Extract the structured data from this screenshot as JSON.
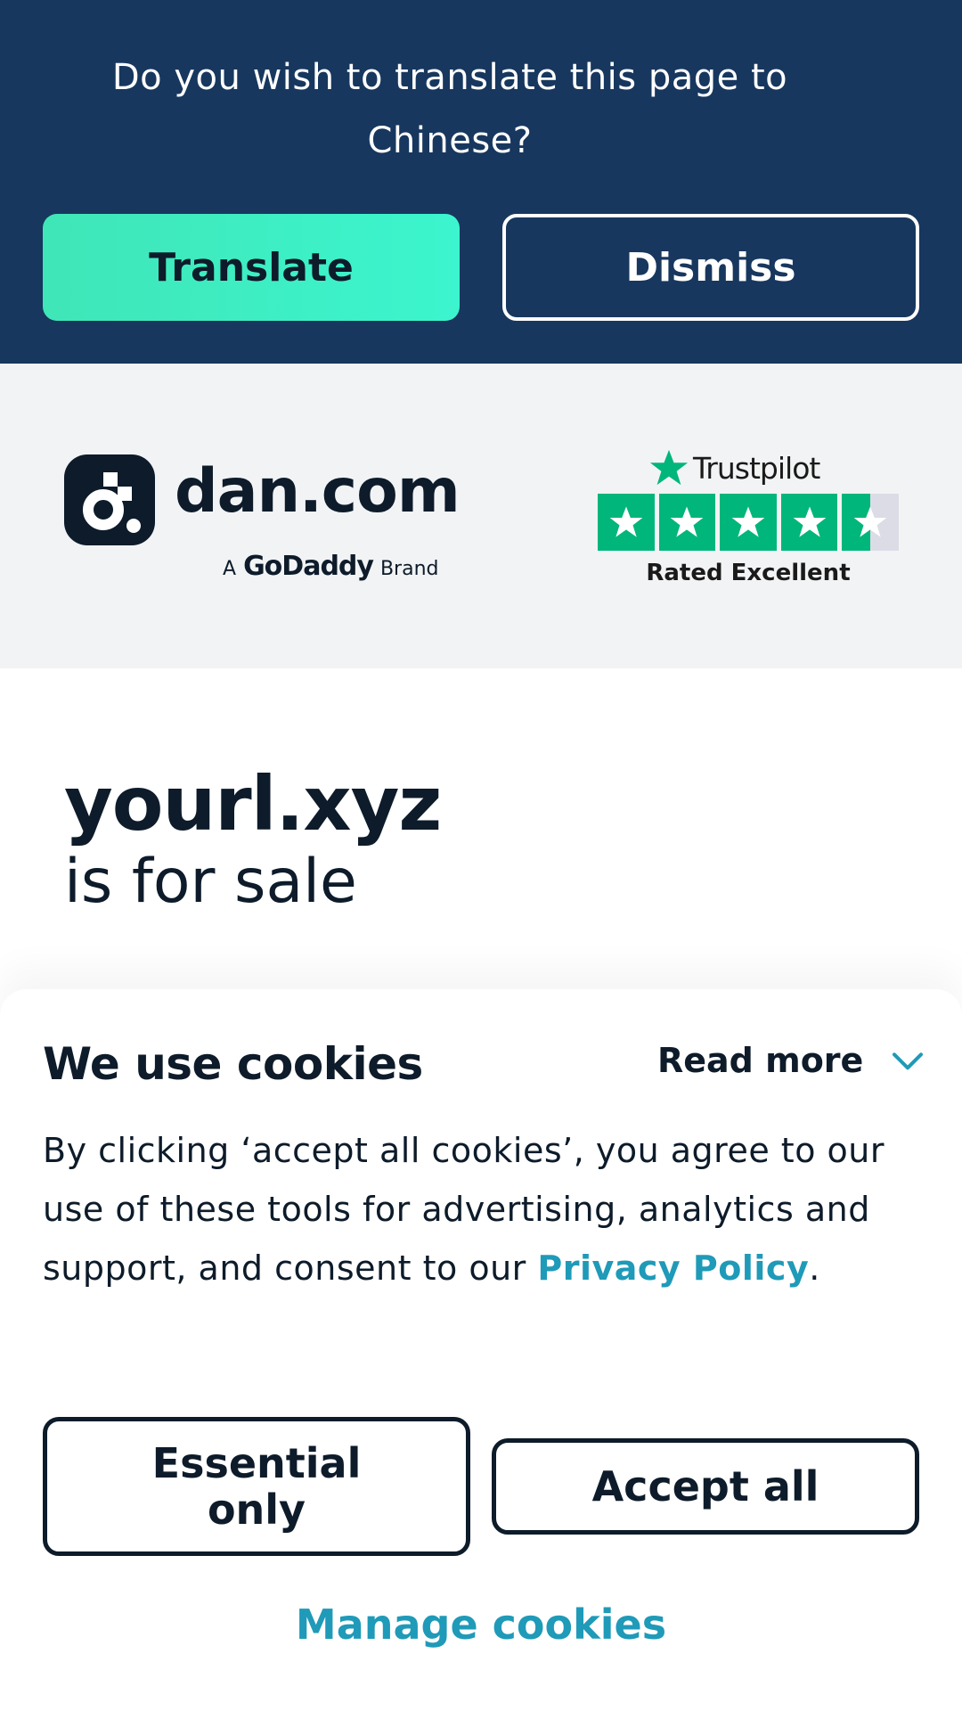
{
  "translate_banner": {
    "question": "Do you wish to translate this page to Chinese?",
    "translate_label": "Translate",
    "dismiss_label": "Dismiss"
  },
  "header": {
    "logo_text": "dan.com",
    "brand_prefix": "A",
    "brand_name": "GoDaddy",
    "brand_suffix": "Brand",
    "trustpilot_label": "Trustpilot",
    "trustpilot_rating_text": "Rated Excellent",
    "trustpilot_stars": 4.5
  },
  "hero": {
    "domain": "yourl.xyz",
    "tagline": "is for sale"
  },
  "cookie_panel": {
    "title": "We use cookies",
    "read_more_label": "Read more",
    "body_text": "By clicking ‘accept all cookies’, you agree to our use of these tools for advertising, analytics and support, and consent to our ",
    "privacy_link": "Privacy Policy",
    "body_end": ".",
    "essential_label": "Essential only",
    "accept_label": "Accept all",
    "manage_label": "Manage cookies"
  },
  "colors": {
    "banner_bg": "#17375e",
    "translate_btn": "#3cf5ce",
    "header_bg": "#f2f3f5",
    "trustpilot_green": "#00b67a",
    "link": "#1f9ab8",
    "text_dark": "#0d1b2a"
  },
  "icons": {
    "logo_mark": "dan-logo-icon",
    "trustpilot_star": "trustpilot-star-icon",
    "read_more": "chevron-down-icon"
  }
}
